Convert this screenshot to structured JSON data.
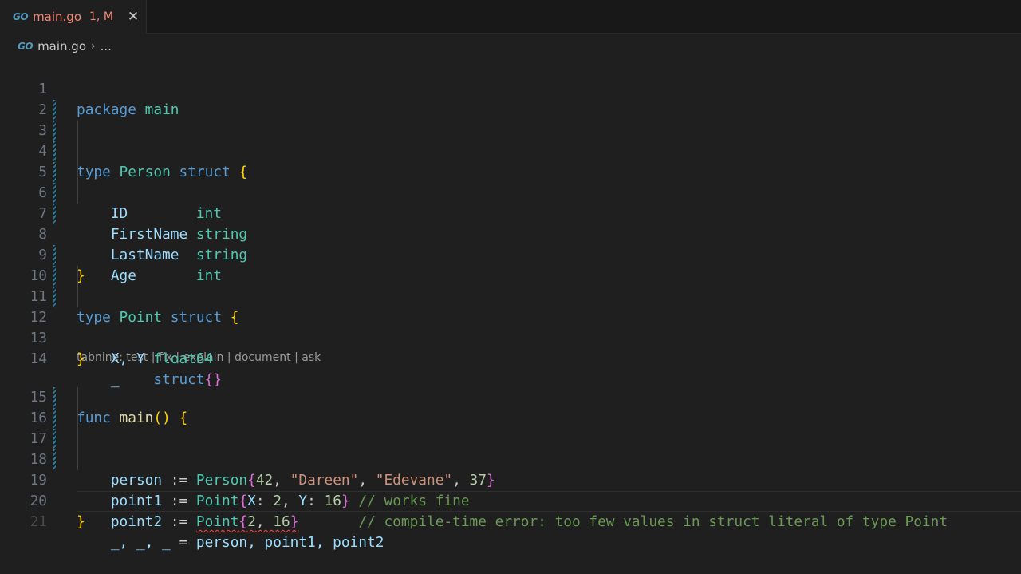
{
  "tab": {
    "icon": "go-icon",
    "icon_label": "GO",
    "filename": "main.go",
    "status": "1, M",
    "close_glyph": "✕"
  },
  "breadcrumb": {
    "file": "main.go",
    "separator": "›",
    "more": "..."
  },
  "codelens": "tabnine: test | fix | explain | document | ask",
  "line_numbers": [
    "1",
    "2",
    "3",
    "4",
    "5",
    "6",
    "7",
    "8",
    "9",
    "10",
    "11",
    "12",
    "13",
    "14",
    "15",
    "16",
    "17",
    "18",
    "19",
    "20",
    "21"
  ],
  "code": {
    "l1": {
      "kw": "package",
      "name": "main"
    },
    "l3": {
      "kw": "type",
      "name": "Person",
      "kw2": "struct",
      "brace": "{"
    },
    "l4": {
      "field": "ID        ",
      "type": "int"
    },
    "l5": {
      "field": "FirstName ",
      "type": "string"
    },
    "l6": {
      "field": "LastName  ",
      "type": "string"
    },
    "l7": {
      "field": "Age       ",
      "type": "int"
    },
    "l8": {
      "brace": "}"
    },
    "l10": {
      "kw": "type",
      "name": "Point",
      "kw2": "struct",
      "brace": "{"
    },
    "l11": {
      "fields": "X, Y",
      "type": "float64"
    },
    "l12": {
      "field": "_    ",
      "kw": "struct",
      "braces": "{}"
    },
    "l13": {
      "brace": "}"
    },
    "l15": {
      "kw": "func",
      "name": "main",
      "parens": "()",
      "brace": "{"
    },
    "l16": {
      "var": "person",
      "op": " := ",
      "type": "Person",
      "open": "{",
      "n1": "42",
      "c1": ", ",
      "s1": "\"Dareen\"",
      "c2": ", ",
      "s2": "\"Edevane\"",
      "c3": ", ",
      "n2": "37",
      "close": "}"
    },
    "l17": {
      "var": "point1",
      "op": " := ",
      "type": "Point",
      "open": "{",
      "k1": "X",
      "c1": ": ",
      "n1": "2",
      "c2": ", ",
      "k2": "Y",
      "c3": ": ",
      "n2": "16",
      "close": "}",
      "comment": " // works fine"
    },
    "l18": {
      "var": "point2",
      "op": " := ",
      "type": "Point",
      "open": "{",
      "n1": "2",
      "c1": ", ",
      "n2": "16",
      "close": "}",
      "pad": "       ",
      "comment": "// compile-time error: too few values in struct literal of type Point"
    },
    "l19": {
      "blanks": "_, _, _",
      "op": " = ",
      "vars": "person, point1, point2"
    },
    "l20": {
      "brace": "}"
    }
  },
  "colors": {
    "keyword": "#569cd6",
    "type": "#4ec9b0",
    "function": "#dcdcaa",
    "variable": "#9cdcfe",
    "string": "#ce9178",
    "number": "#b5cea8",
    "comment": "#6a9955",
    "error_tab": "#f48771",
    "error_squiggle": "#f14c4c"
  }
}
